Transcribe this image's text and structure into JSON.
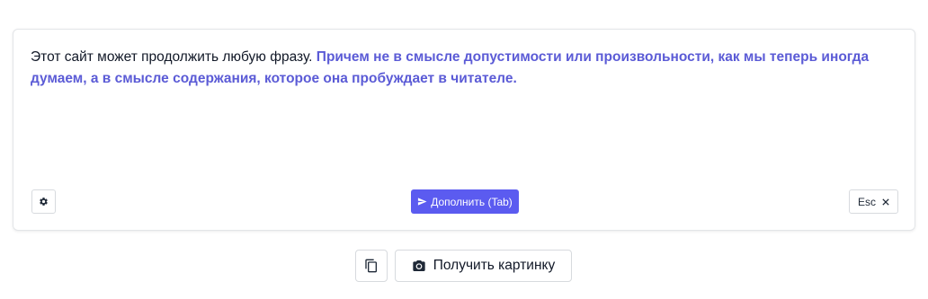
{
  "editor": {
    "prompt_text": "Этот сайт может продолжить любую фразу.",
    "completion_text": "Причем не в смысле допустимости или произвольности, как мы теперь иногда думаем, а в смысле содержания, которое она пробуждает в читателе.",
    "accent_color": "#5b5bd6"
  },
  "toolbar": {
    "settings_icon": "gear-icon",
    "complete_label": "Дополнить (Tab)",
    "complete_icon": "send-icon",
    "escape_label": "Esc",
    "escape_icon": "close-icon",
    "button_color": "#5b5bf0"
  },
  "actions": {
    "copy_icon": "copy-icon",
    "picture_label": "Получить картинку",
    "picture_icon": "camera-icon"
  }
}
